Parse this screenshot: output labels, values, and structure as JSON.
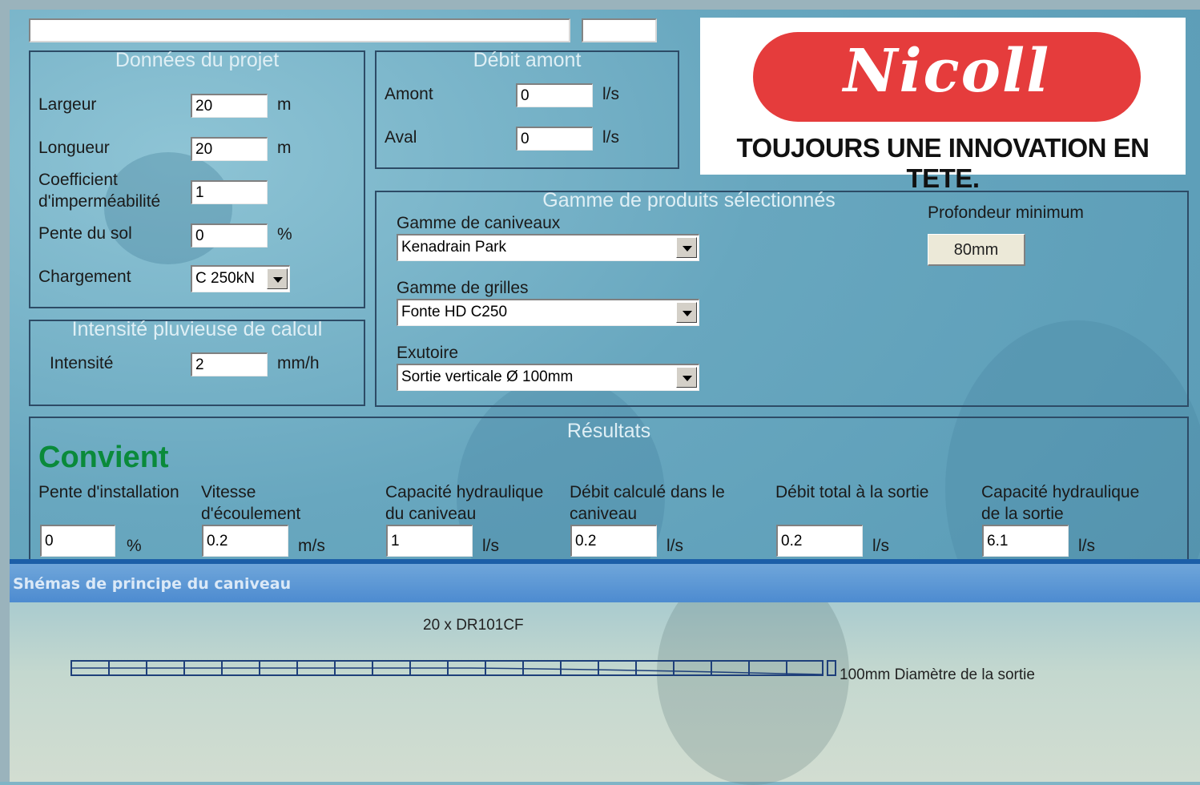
{
  "top": {
    "field_1": "",
    "field_2": ""
  },
  "projet": {
    "title": "Données du projet",
    "largeur": {
      "label": "Largeur",
      "value": "20",
      "unit": "m"
    },
    "longueur": {
      "label": "Longueur",
      "value": "20",
      "unit": "m"
    },
    "coef": {
      "label_1": "Coefficient",
      "label_2": "d'imperméabilité",
      "value": "1"
    },
    "pente": {
      "label": "Pente du sol",
      "value": "0",
      "unit": "%"
    },
    "chargement": {
      "label": "Chargement",
      "value": "C 250kN"
    }
  },
  "intensite": {
    "title": "Intensité pluvieuse de calcul",
    "label": "Intensité",
    "value": "2",
    "unit": "mm/h"
  },
  "debit": {
    "title": "Débit amont",
    "amont": {
      "label": "Amont",
      "value": "0",
      "unit": "l/s"
    },
    "aval": {
      "label": "Aval",
      "value": "0",
      "unit": "l/s"
    }
  },
  "logo": {
    "brand": "Nicoll",
    "slogan": "TOUJOURS UNE INNOVATION EN TETE."
  },
  "gamme": {
    "title": "Gamme de produits sélectionnés",
    "caniveaux": {
      "label": "Gamme de caniveaux",
      "value": "Kenadrain Park"
    },
    "grilles": {
      "label": "Gamme de grilles",
      "value": "Fonte HD C250"
    },
    "exutoire": {
      "label": "Exutoire",
      "value": "Sortie verticale Ø 100mm"
    },
    "profondeur": {
      "label": "Profondeur minimum",
      "value": "80mm"
    }
  },
  "resultats": {
    "title": "Résultats",
    "status": "Convient",
    "pente": {
      "label_1": "Pente d'installation",
      "value": "0",
      "unit": "%"
    },
    "vitesse": {
      "label_1": "Vitesse",
      "label_2": "d'écoulement",
      "value": "0.2",
      "unit": "m/s"
    },
    "capacite": {
      "label_1": "Capacité hydraulique",
      "label_2": "du caniveau",
      "value": "1",
      "unit": "l/s"
    },
    "debit_calc": {
      "label_1": "Débit calculé dans le",
      "label_2": "caniveau",
      "value": "0.2",
      "unit": "l/s"
    },
    "debit_total": {
      "label_1": "Débit total à la sortie",
      "value": "0.2",
      "unit": "l/s"
    },
    "capacite_sortie": {
      "label_1": "Capacité hydraulique",
      "label_2": "de la sortie",
      "value": "6.1",
      "unit": "l/s"
    }
  },
  "schema": {
    "title": "Shémas de principe du caniveau",
    "count_label": "20  x DR101CF",
    "outlet_label": "100mm Diamètre de la sortie"
  },
  "colors": {
    "status_green": "#0a8a3a",
    "band_blue": "#4d8bd0",
    "logo_red": "#e53c3c"
  }
}
